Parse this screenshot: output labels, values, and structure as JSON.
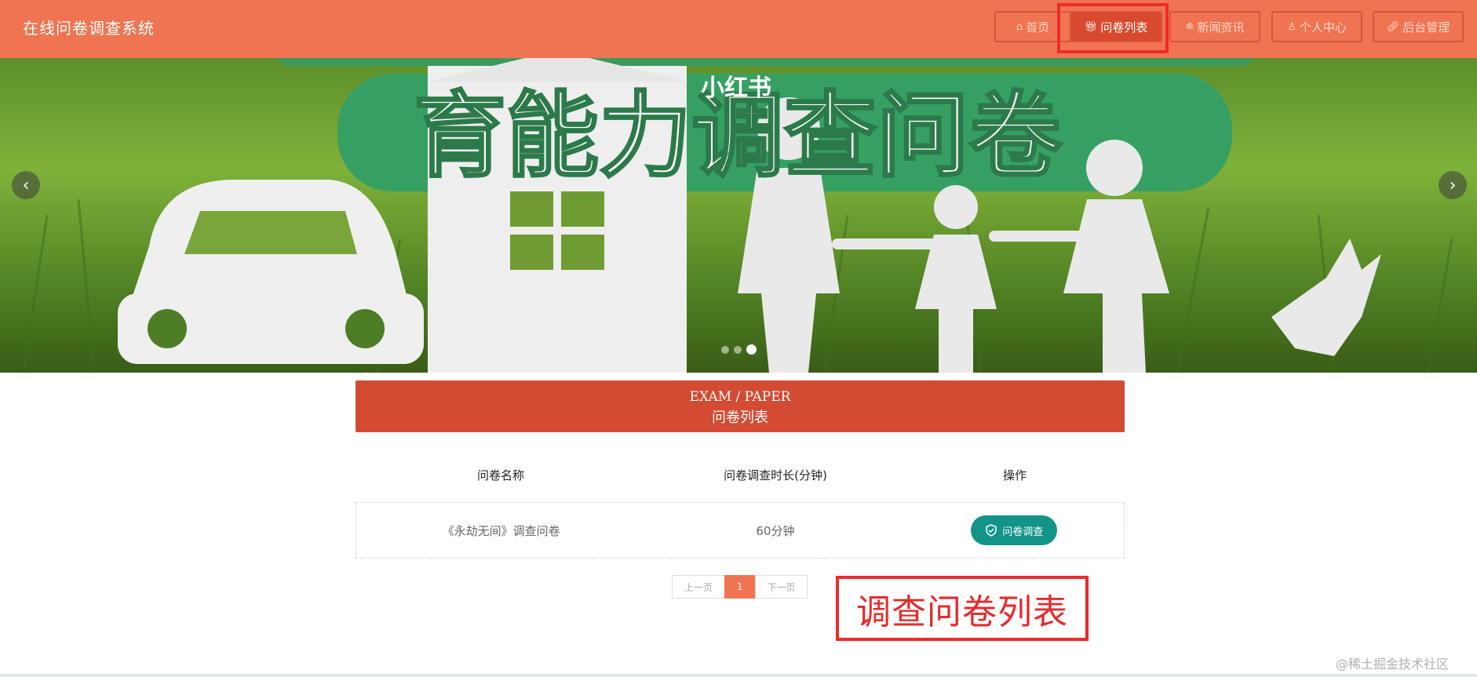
{
  "app": {
    "title": "在线问卷调查系统"
  },
  "nav": [
    {
      "icon": "home-icon",
      "label": "首页"
    },
    {
      "icon": "gift-icon",
      "label": "问卷列表"
    },
    {
      "icon": "snowflake-icon",
      "label": "新闻资讯"
    },
    {
      "icon": "user-icon",
      "label": "个人中心"
    },
    {
      "icon": "link-icon",
      "label": "后台管理"
    }
  ],
  "banner": {
    "headline": "育能力调查问卷",
    "small_text": "小红书",
    "slides_total": 3,
    "active_slide": 3
  },
  "section": {
    "title_en": "EXAM / PAPER",
    "title_cn": "问卷列表"
  },
  "table": {
    "headers": [
      "问卷名称",
      "问卷调查时长(分钟)",
      "操作"
    ],
    "rows": [
      {
        "name": "《永劫无间》调查问卷",
        "duration": "60分钟",
        "action": "问卷调查"
      }
    ]
  },
  "pagination": {
    "prev": "上一页",
    "page": "1",
    "next": "下一页"
  },
  "annotation": "调查问卷列表",
  "watermark": "@稀土掘金技术社区",
  "colors": {
    "header": "#f07451",
    "section": "#d24b32",
    "action": "#129488",
    "annotation": "#ef2a2a"
  }
}
